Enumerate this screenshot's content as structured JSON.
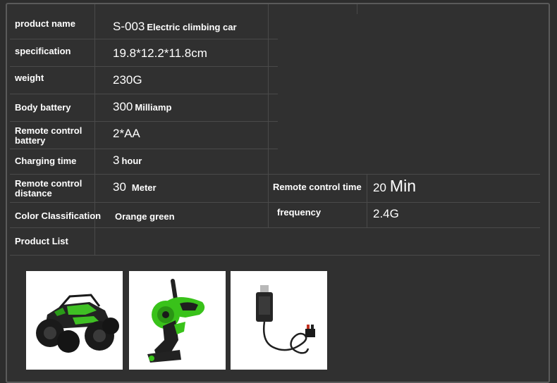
{
  "table": {
    "rows": [
      {
        "label": "product name",
        "value_main": "S-003",
        "value_small": "Electric climbing car"
      },
      {
        "label": "specification",
        "value_main": "19.8*12.2*11.8cm",
        "value_small": ""
      },
      {
        "label": "weight",
        "value_main": "230G",
        "value_small": ""
      },
      {
        "label": "Body battery",
        "value_main": "300",
        "value_small": "Milliamp"
      },
      {
        "label": "Remote control battery",
        "value_main": "2*AA",
        "value_small": ""
      },
      {
        "label": "Charging time",
        "value_main": "3",
        "value_small": "hour"
      },
      {
        "label": "Remote control distance",
        "value_main": "30",
        "value_small": "Meter"
      },
      {
        "label": "Color Classification",
        "value_main": "",
        "value_small": "Orange green"
      },
      {
        "label": "Product List",
        "value_main": "",
        "value_small": ""
      }
    ],
    "extra": [
      {
        "label": "Remote control time",
        "value_main": "20",
        "value_big": "Min"
      },
      {
        "label": "frequency",
        "value_main": "2.4G"
      }
    ]
  },
  "product_list": [
    {
      "icon": "rc-car-icon"
    },
    {
      "icon": "remote-controller-icon"
    },
    {
      "icon": "usb-charger-icon"
    }
  ],
  "colors": {
    "background": "#2d2d2d",
    "accent_green": "#39c21a"
  }
}
